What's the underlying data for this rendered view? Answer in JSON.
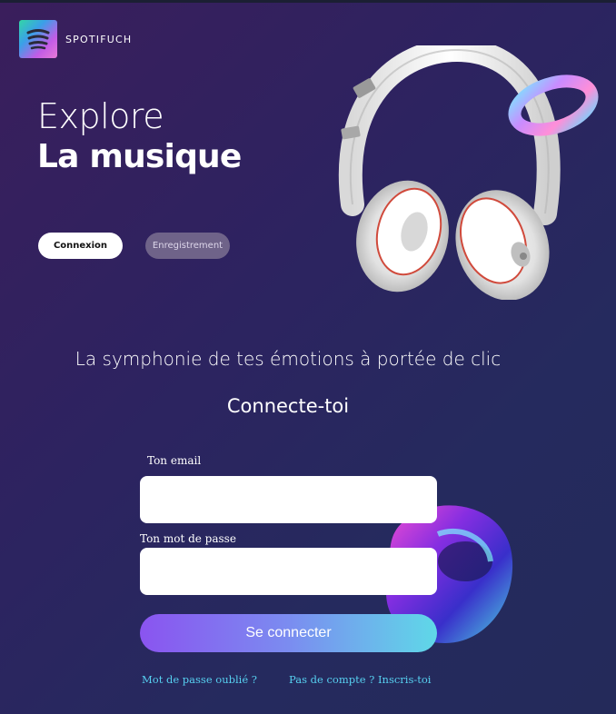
{
  "brand": {
    "name": "SPOTIFUCH",
    "logo_icon": "spotify-like-logo-icon"
  },
  "hero": {
    "line1": "Explore",
    "line2": "La musique"
  },
  "tabs": {
    "login": "Connexion",
    "register": "Enregistrement"
  },
  "tagline": "La symphonie de tes émotions  à portée de clic",
  "form": {
    "title": "Connecte-toi",
    "email_label": "Ton email",
    "email_value": "",
    "password_label": "Ton mot de passe",
    "password_value": "",
    "submit_label": "Se connecter"
  },
  "links": {
    "forgot": "Mot de passe oublié ?",
    "signup": "Pas de compte ? Inscris-toi"
  },
  "colors": {
    "background_start": "#3a1e5c",
    "background_end": "#242a5a",
    "accent_link": "#57d0f0",
    "button_gradient_start": "#8a54f0",
    "button_gradient_end": "#5fd8e8"
  }
}
